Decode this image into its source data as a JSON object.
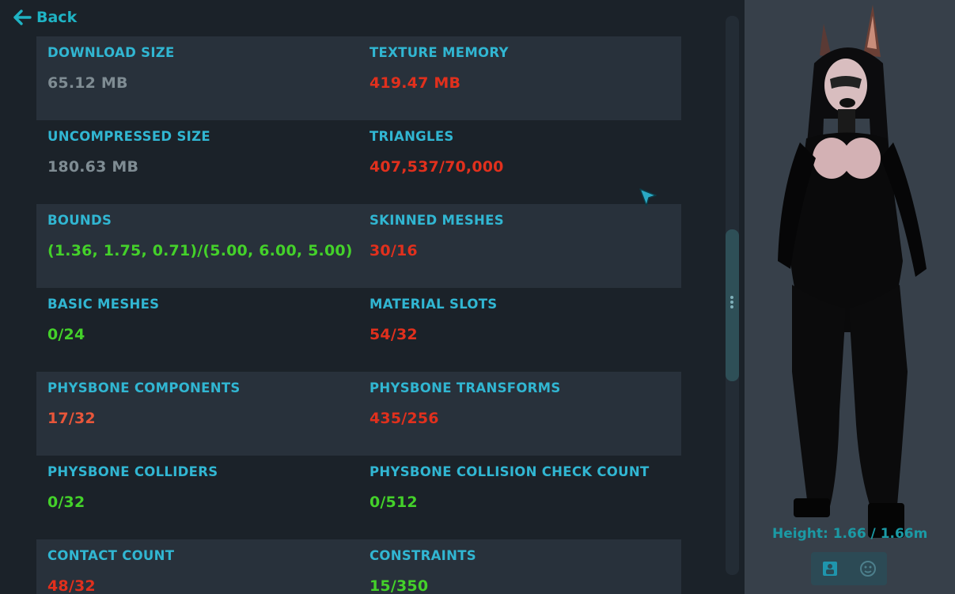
{
  "nav": {
    "back_label": "Back"
  },
  "stats": [
    {
      "left": {
        "label": "DOWNLOAD SIZE",
        "value": "65.12 MB",
        "status": "gray"
      },
      "right": {
        "label": "TEXTURE MEMORY",
        "value": "419.47 MB",
        "status": "red"
      }
    },
    {
      "left": {
        "label": "UNCOMPRESSED SIZE",
        "value": "180.63 MB",
        "status": "gray"
      },
      "right": {
        "label": "TRIANGLES",
        "value": "407,537/70,000",
        "status": "red"
      }
    },
    {
      "left": {
        "label": "BOUNDS",
        "value": "(1.36, 1.75, 0.71)/(5.00, 6.00, 5.00)",
        "status": "green"
      },
      "right": {
        "label": "SKINNED MESHES",
        "value": "30/16",
        "status": "red"
      }
    },
    {
      "left": {
        "label": "BASIC MESHES",
        "value": "0/24",
        "status": "green"
      },
      "right": {
        "label": "MATERIAL SLOTS",
        "value": "54/32",
        "status": "red"
      }
    },
    {
      "left": {
        "label": "PHYSBONE COMPONENTS",
        "value": "17/32",
        "status": "orange"
      },
      "right": {
        "label": "PHYSBONE TRANSFORMS",
        "value": "435/256",
        "status": "red"
      }
    },
    {
      "left": {
        "label": "PHYSBONE COLLIDERS",
        "value": "0/32",
        "status": "green"
      },
      "right": {
        "label": "PHYSBONE COLLISION CHECK COUNT",
        "value": "0/512",
        "status": "green"
      }
    },
    {
      "left": {
        "label": "CONTACT COUNT",
        "value": "48/32",
        "status": "red"
      },
      "right": {
        "label": "CONSTRAINTS",
        "value": "15/350",
        "status": "green"
      }
    }
  ],
  "preview": {
    "height_text": "Height: 1.66 / 1.66m",
    "buttons": [
      {
        "icon": "avatar-card-icon"
      },
      {
        "icon": "face-icon"
      }
    ]
  },
  "colors": {
    "accent": "#31b6d2",
    "gray": "#7f8c93",
    "red": "#e1301d",
    "green": "#44d12a",
    "orange": "#e8563a"
  }
}
